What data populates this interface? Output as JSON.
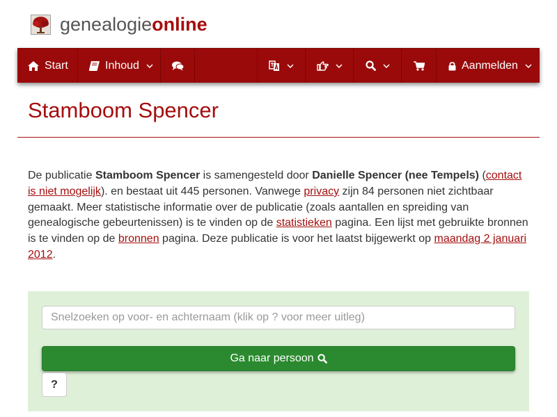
{
  "brand": {
    "name_part1": "genealogie",
    "name_part2": "online",
    "accent": "#a50d0d"
  },
  "nav": {
    "start_label": "Start",
    "inhoud_label": "Inhoud",
    "login_label": "Aanmelden",
    "icons": [
      "home-icon",
      "book-icon",
      "comments-icon",
      "language-icon",
      "hand-pointer-icon",
      "search-icon",
      "shopping-cart-icon",
      "lock-icon",
      "chevron-down-icon"
    ],
    "background": "#9b0a0a"
  },
  "page": {
    "title": "Stamboom Spencer"
  },
  "intro": {
    "t1": "De publicatie ",
    "pub_name": "Stamboom Spencer",
    "t2": " is samengesteld door ",
    "author": "Danielle Spencer (nee Tempels)",
    "t3": " (",
    "contact_link": "contact is niet mogelijk",
    "t4": "). en bestaat uit 445 personen. Vanwege ",
    "privacy_link": "privacy",
    "t5": " zijn 84 personen niet zichtbaar gemaakt. Meer statistische informatie over de publicatie (zoals aantallen en spreiding van genealogische gebeurtenissen) is te vinden op de ",
    "stats_link": "statistieken",
    "t6": " pagina. Een lijst met gebruikte bronnen is te vinden op de ",
    "sources_link": "bronnen",
    "t7": " pagina. Deze publicatie is voor het laatst bijgewerkt op ",
    "date_link": "maandag 2 januari 2012",
    "t8": "."
  },
  "search": {
    "placeholder": "Snelzoeken op voor- en achternaam (klik op ? voor meer uitleg)",
    "value": "",
    "go_label": "Ga naar persoon",
    "help_label": "?",
    "panel_color": "#dff0d8",
    "button_color": "#2b8a2f"
  }
}
